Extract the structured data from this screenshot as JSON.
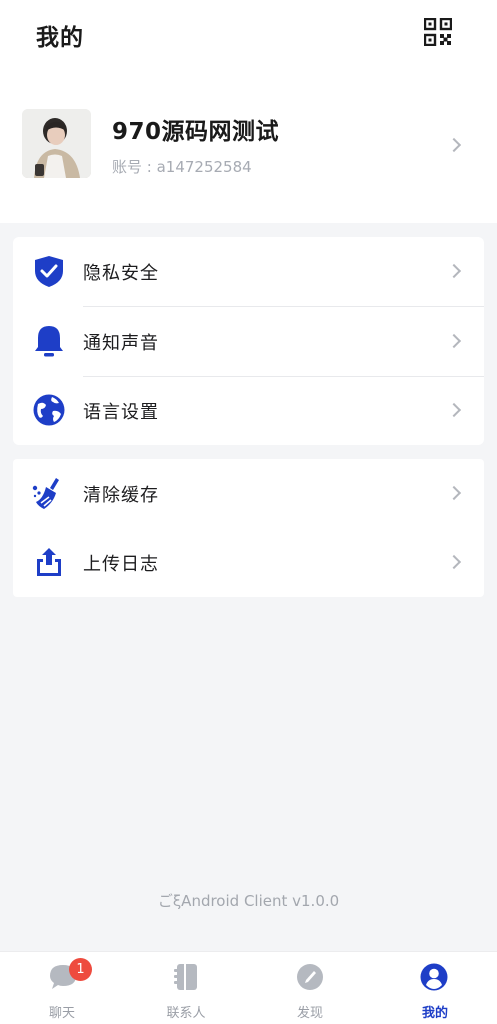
{
  "header": {
    "title": "我的",
    "qr_icon": "qrcode-icon"
  },
  "profile": {
    "name": "970源码网测试",
    "account": "账号 : a147252584",
    "avatar_icon": "user-photo"
  },
  "menu_group_1": [
    {
      "label": "隐私安全",
      "icon": "shield-check-icon"
    },
    {
      "label": "通知声音",
      "icon": "bell-icon"
    },
    {
      "label": "语言设置",
      "icon": "globe-icon"
    }
  ],
  "menu_group_2": [
    {
      "label": "清除缓存",
      "icon": "broom-icon"
    },
    {
      "label": "上传日志",
      "icon": "upload-icon"
    }
  ],
  "version": "ごξAndroid Client v1.0.0",
  "tabbar": {
    "tabs": [
      {
        "label": "聊天",
        "icon": "chat-icon",
        "badge": "1",
        "active": false
      },
      {
        "label": "联系人",
        "icon": "contacts-icon",
        "active": false
      },
      {
        "label": "发现",
        "icon": "compass-icon",
        "active": false
      },
      {
        "label": "我的",
        "icon": "profile-icon",
        "active": true
      }
    ]
  },
  "colors": {
    "accent": "#1e3ec7",
    "badge": "#ee4b3e",
    "background": "#f4f5f7",
    "inactive": "#9a9ea6"
  }
}
